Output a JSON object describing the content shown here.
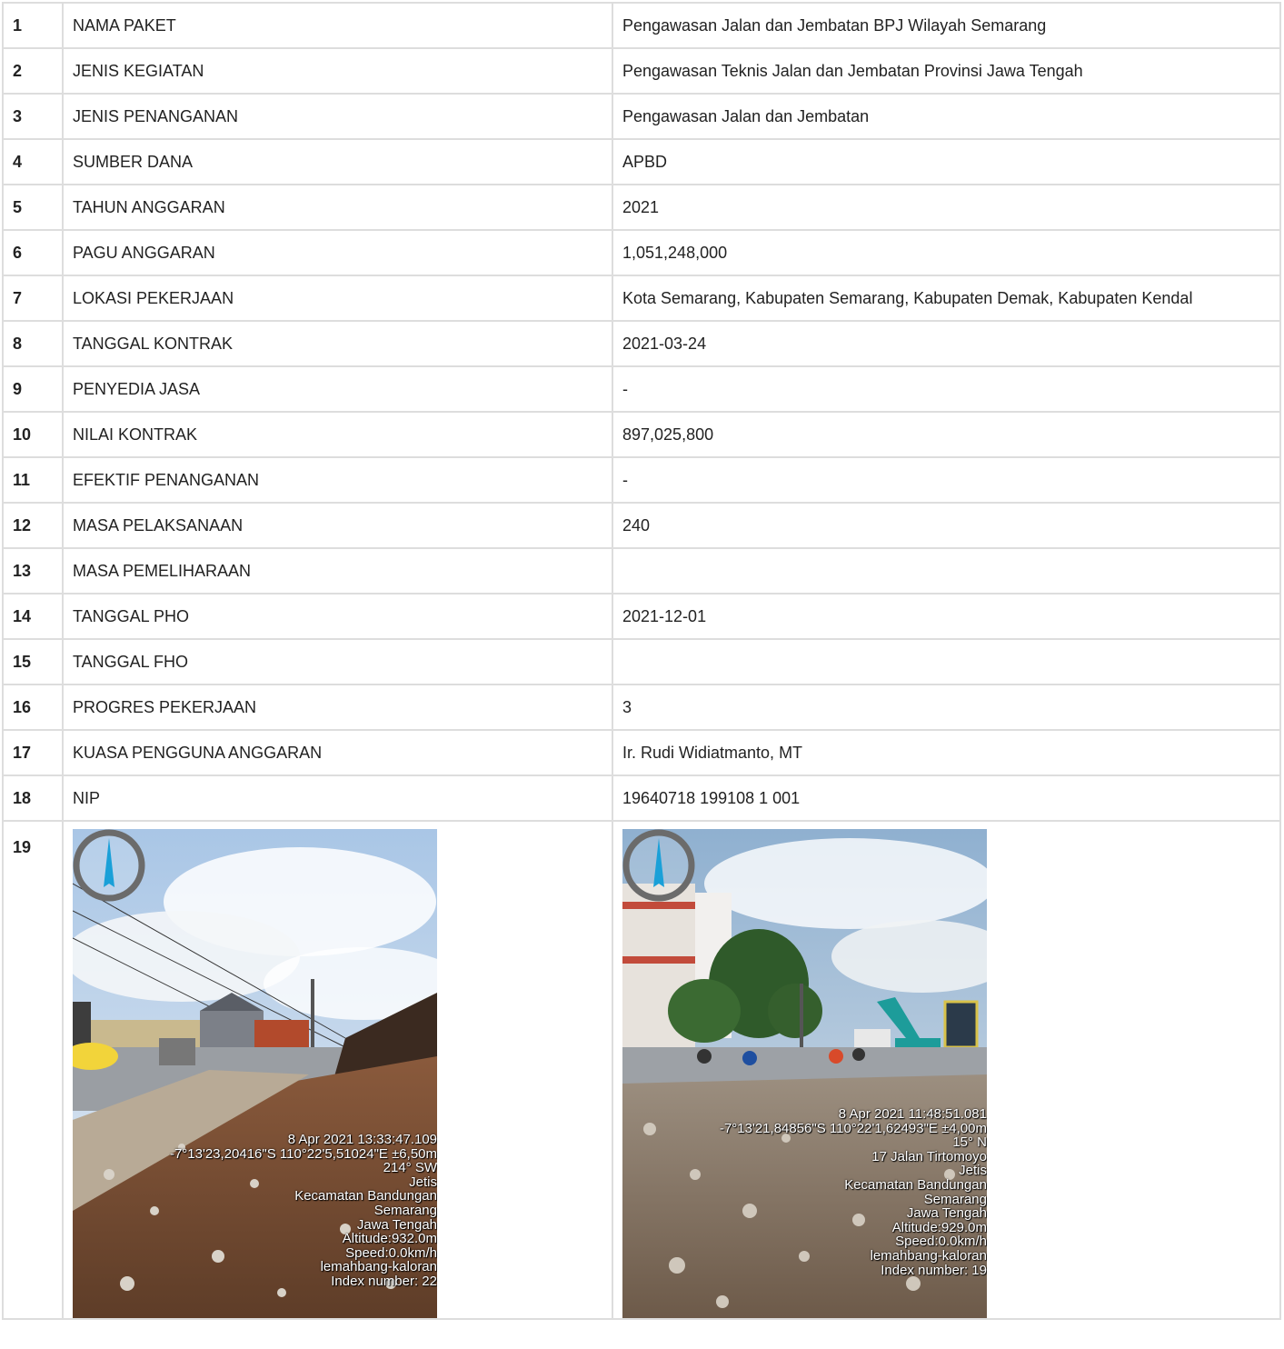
{
  "rows": [
    {
      "no": "1",
      "label": "NAMA PAKET",
      "value": "Pengawasan Jalan dan Jembatan BPJ Wilayah Semarang"
    },
    {
      "no": "2",
      "label": "JENIS KEGIATAN",
      "value": "Pengawasan Teknis Jalan dan Jembatan Provinsi Jawa Tengah"
    },
    {
      "no": "3",
      "label": "JENIS PENANGANAN",
      "value": "Pengawasan Jalan dan Jembatan"
    },
    {
      "no": "4",
      "label": "SUMBER DANA",
      "value": "APBD"
    },
    {
      "no": "5",
      "label": "TAHUN ANGGARAN",
      "value": "2021"
    },
    {
      "no": "6",
      "label": "PAGU ANGGARAN",
      "value": "1,051,248,000"
    },
    {
      "no": "7",
      "label": "LOKASI PEKERJAAN",
      "value": "Kota Semarang, Kabupaten Semarang, Kabupaten Demak, Kabupaten Kendal"
    },
    {
      "no": "8",
      "label": "TANGGAL KONTRAK",
      "value": "2021-03-24"
    },
    {
      "no": "9",
      "label": "PENYEDIA JASA",
      "value": "-"
    },
    {
      "no": "10",
      "label": "NILAI KONTRAK",
      "value": "897,025,800"
    },
    {
      "no": "11",
      "label": "EFEKTIF PENANGANAN",
      "value": "-"
    },
    {
      "no": "12",
      "label": "MASA PELAKSANAAN",
      "value": "240"
    },
    {
      "no": "13",
      "label": "MASA PEMELIHARAAN",
      "value": ""
    },
    {
      "no": "14",
      "label": "TANGGAL PHO",
      "value": "2021-12-01"
    },
    {
      "no": "15",
      "label": "TANGGAL FHO",
      "value": ""
    },
    {
      "no": "16",
      "label": "PROGRES PEKERJAAN",
      "value": "3"
    },
    {
      "no": "17",
      "label": "KUASA PENGGUNA ANGGARAN",
      "value": "Ir. Rudi Widiatmanto, MT"
    },
    {
      "no": "18",
      "label": "NIP",
      "value": "19640718 199108 1 001"
    }
  ],
  "photo_row": {
    "no": "19",
    "photo1": {
      "overlay": [
        "8 Apr 2021 13:33:47.109",
        "-7°13'23,20416\"S 110°22'5,51024\"E ±6,50m",
        "214° SW",
        "Jetis",
        "Kecamatan Bandungan",
        "Semarang",
        "Jawa Tengah",
        "Altitude:932.0m",
        "Speed:0.0km/h",
        "lemahbang-kaloran",
        "Index number: 22"
      ]
    },
    "photo2": {
      "overlay": [
        "8 Apr 2021 11:48:51.081",
        "-7°13'21,84856\"S 110°22'1,62493\"E ±4,00m",
        "15° N",
        "17 Jalan Tirtomoyo",
        "Jetis",
        "Kecamatan Bandungan",
        "Semarang",
        "Jawa Tengah",
        "Altitude:929.0m",
        "Speed:0.0km/h",
        "lemahbang-kaloran",
        "Index number: 19"
      ]
    }
  },
  "colors": {
    "border": "#dddddd",
    "text": "#222222",
    "overlay_text": "#ffffff"
  }
}
